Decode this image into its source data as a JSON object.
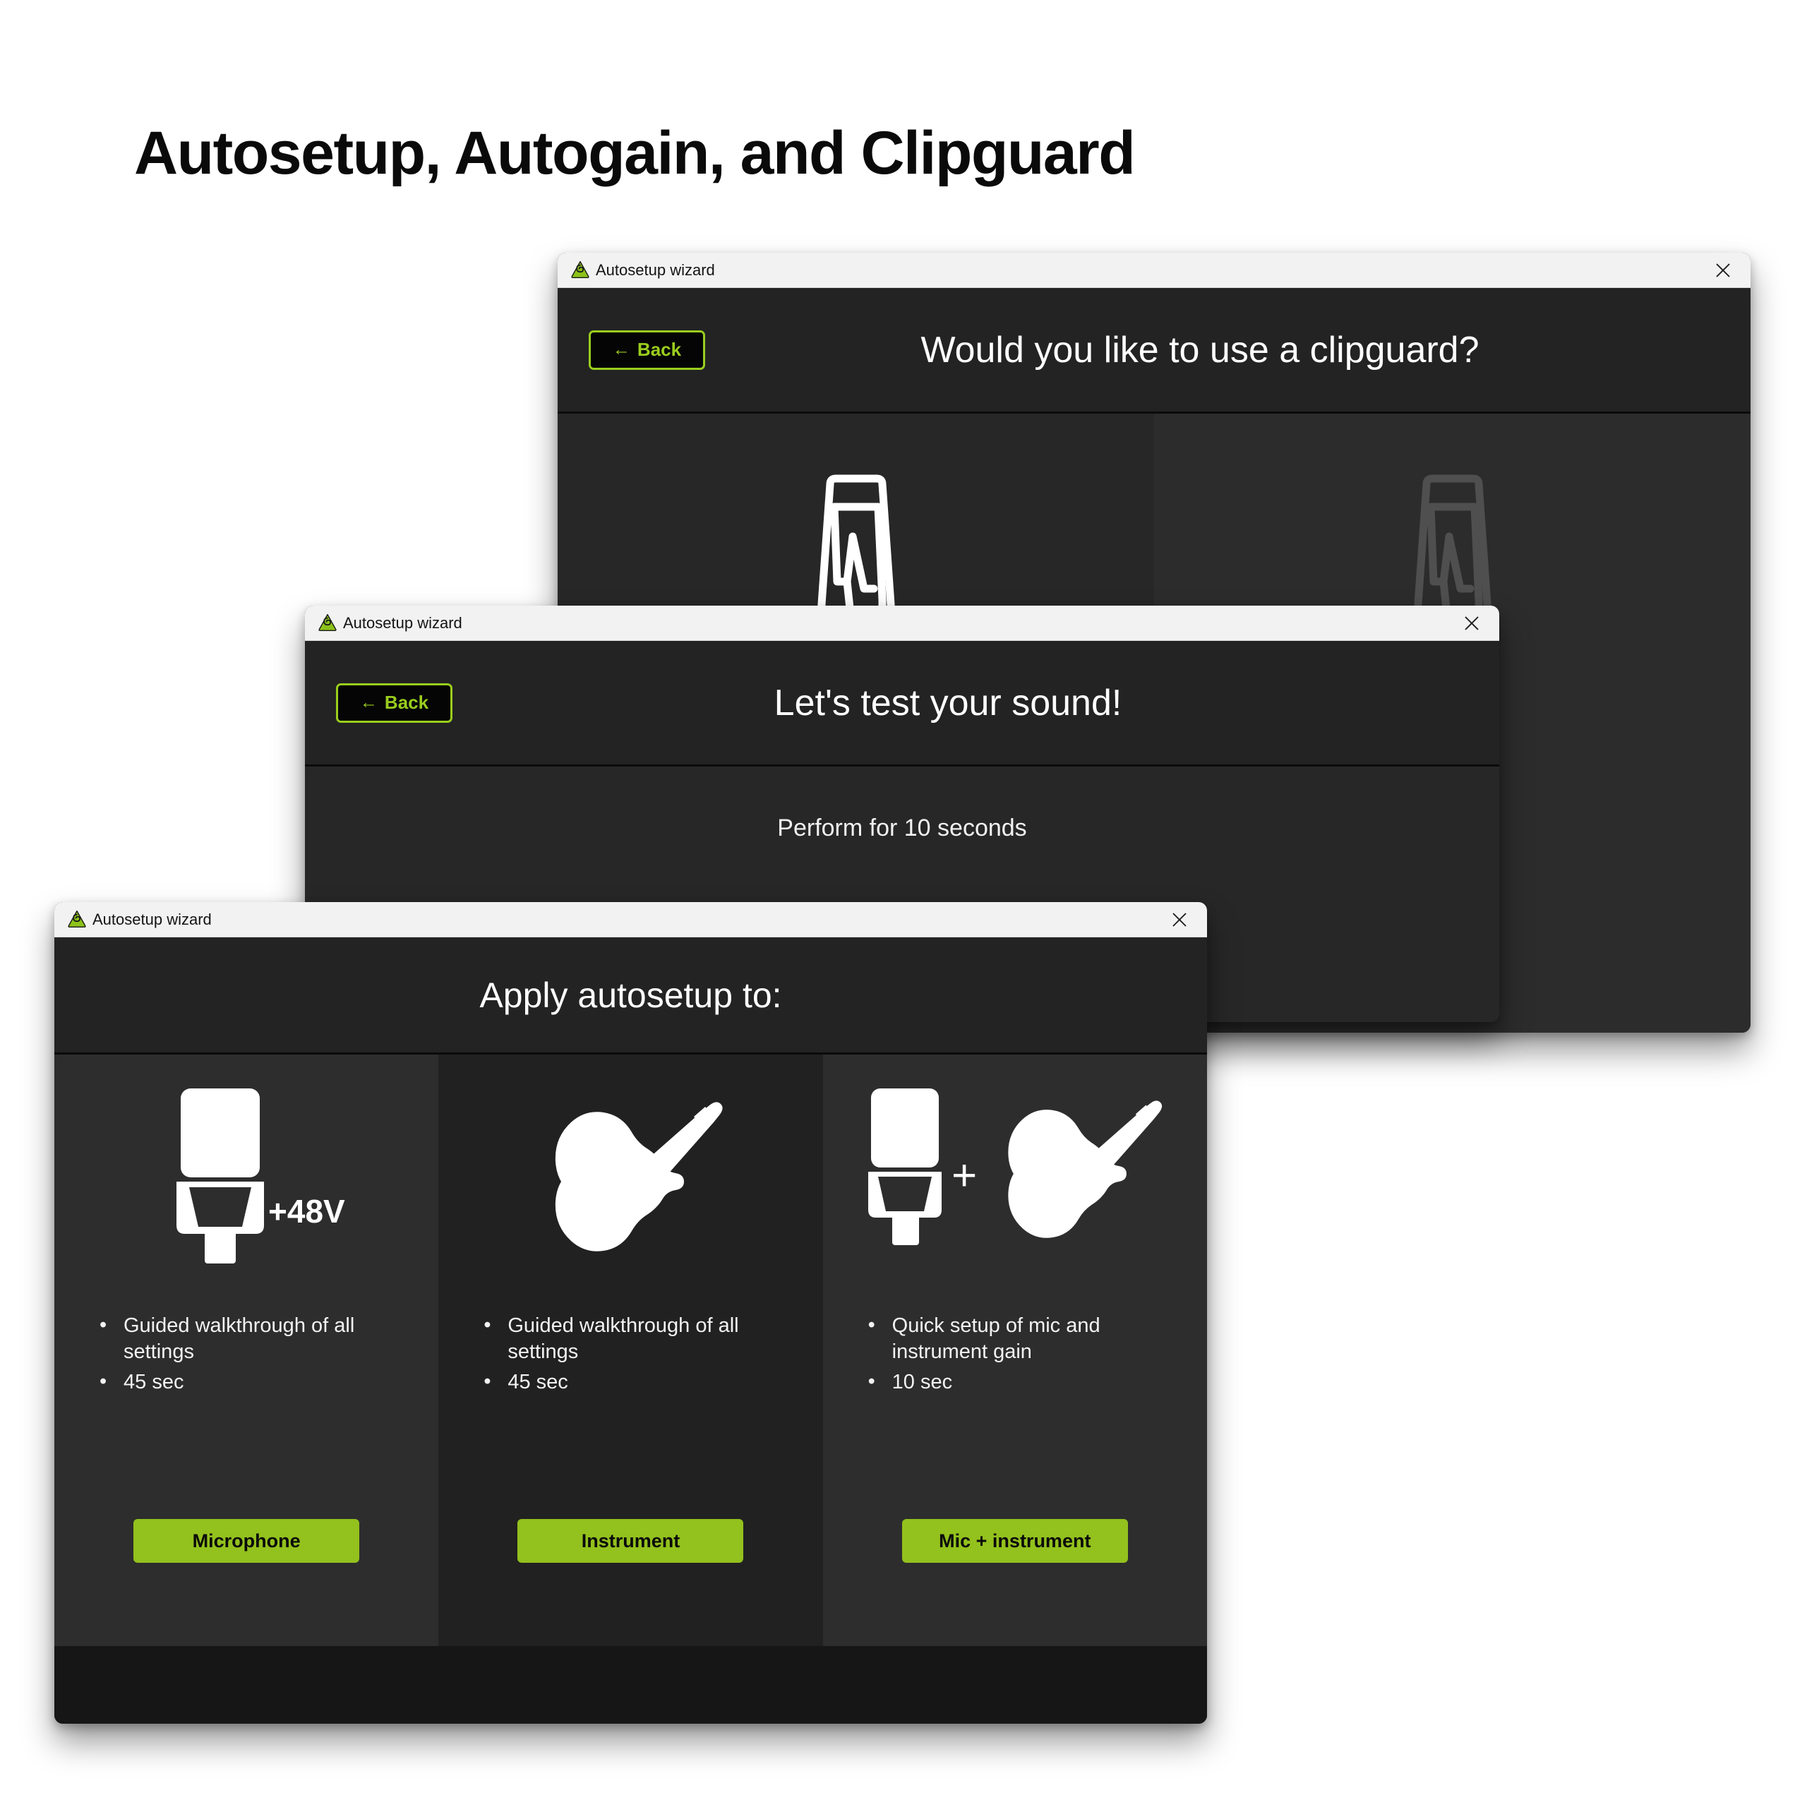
{
  "page": {
    "title": "Autosetup, Autogain, and Clipguard",
    "background_color": "#ffffff"
  },
  "colors": {
    "accent_green": "#93c11d",
    "accent_green_border": "#9acd1e",
    "window_dark": "#232323",
    "card_light": "#2d2d2d",
    "card_dark": "#212121",
    "footer_dark": "#161616",
    "titlebar": "#f2f2f2",
    "text_white": "#ffffff"
  },
  "windows": {
    "clipguard": {
      "titlebar": {
        "app_name": "Autosetup wizard",
        "logo_icon": "focusrite-spiral-logo-icon",
        "close_icon": "close-icon"
      },
      "back_label": "Back",
      "back_arrow": "←",
      "heading": "Would you like to use a clipguard?",
      "panes": [
        {
          "icon": "clipguard-clip-icon",
          "state": "enabled"
        },
        {
          "icon": "clipguard-clip-icon",
          "state": "dimmed"
        }
      ]
    },
    "testsound": {
      "titlebar": {
        "app_name": "Autosetup wizard",
        "logo_icon": "focusrite-spiral-logo-icon",
        "close_icon": "close-icon"
      },
      "back_label": "Back",
      "back_arrow": "←",
      "heading": "Let's test your sound!",
      "subtitle": "Perform for 10 seconds"
    },
    "autosetup": {
      "titlebar": {
        "app_name": "Autosetup wizard",
        "logo_icon": "focusrite-spiral-logo-icon",
        "close_icon": "close-icon"
      },
      "heading": "Apply autosetup to:",
      "cards": [
        {
          "icon": "microphone-icon",
          "badge": "+48V",
          "bullets": [
            "Guided walkthrough of all settings",
            "45 sec"
          ],
          "cta_label": "Microphone"
        },
        {
          "icon": "electric-guitar-icon",
          "badge": "",
          "bullets": [
            "Guided walkthrough of all settings",
            "45 sec"
          ],
          "cta_label": "Instrument"
        },
        {
          "icon": "microphone-plus-guitar-icon",
          "badge": "",
          "plus_glyph": "+",
          "bullets": [
            "Quick setup of mic and instrument gain",
            "10 sec"
          ],
          "cta_label": "Mic + instrument"
        }
      ]
    }
  }
}
